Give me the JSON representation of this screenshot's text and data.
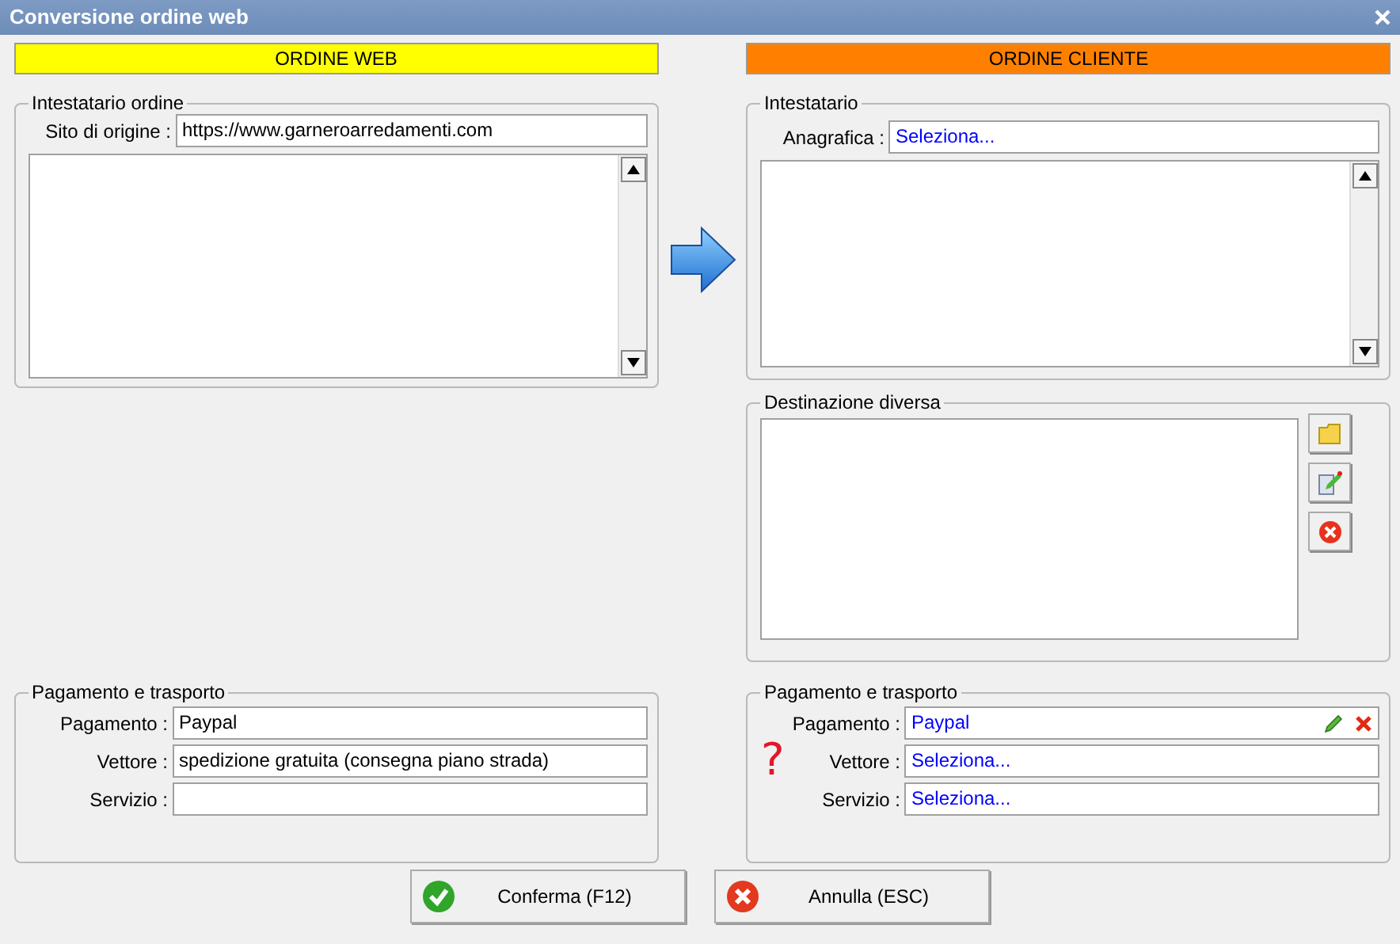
{
  "window": {
    "title": "Conversione ordine web"
  },
  "left": {
    "header": {
      "label": "ORDINE WEB",
      "color": "#ffff00"
    },
    "holder": {
      "legend": "Intestatario ordine",
      "label": "Sito di origine :",
      "value": "https://www.garneroarredamenti.com"
    },
    "payment": {
      "legend": "Pagamento e trasporto",
      "rows": [
        {
          "label": "Pagamento :",
          "value": "Paypal",
          "kind": "text"
        },
        {
          "label": "Vettore :",
          "value": "spedizione gratuita (consegna piano strada)",
          "kind": "text"
        },
        {
          "label": "Servizio :",
          "kind": "text"
        }
      ]
    }
  },
  "right": {
    "header": {
      "label": "ORDINE CLIENTE",
      "color": "#ff8000"
    },
    "holder": {
      "legend": "Intestatario",
      "label": "Anagrafica :",
      "value": "Seleziona..."
    },
    "destination": {
      "legend": "Destinazione diversa"
    },
    "payment": {
      "legend": "Pagamento e trasporto",
      "warning": "?",
      "rows": [
        {
          "label": "Pagamento :",
          "value": "Paypal",
          "kind": "picker-actions"
        },
        {
          "label": "Vettore :",
          "value": "Seleziona...",
          "kind": "picker"
        },
        {
          "label": "Servizio :",
          "value": "Seleziona...",
          "kind": "picker"
        }
      ]
    }
  },
  "buttons": [
    {
      "label": "Conferma (F12)",
      "kind": "confirm"
    },
    {
      "label": "Annulla (ESC)",
      "kind": "cancel"
    }
  ]
}
